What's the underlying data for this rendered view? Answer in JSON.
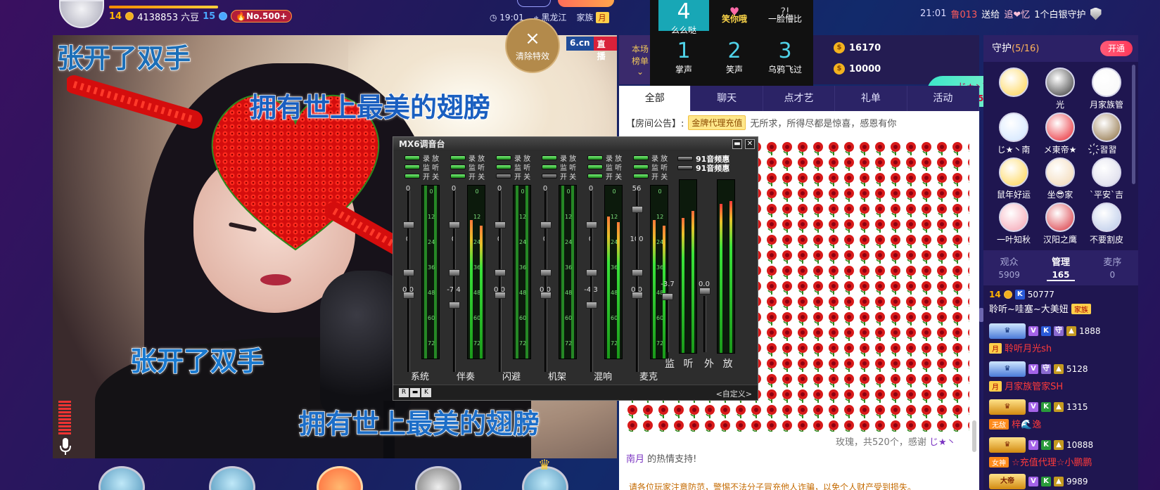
{
  "topbar": {
    "level": "14",
    "coins": "4138853 六豆",
    "level2": "15",
    "rank": "No.500+",
    "level_progress_percent": 100,
    "time": "19:01",
    "location": "黑龙江",
    "clan_label": "家族",
    "clan_tag": "月",
    "notice_time": "21:01",
    "notice_user": "鲁013",
    "notice_verb": "送给",
    "notice_target": "追❤忆",
    "notice_gift": "1个白银守护"
  },
  "video": {
    "brand": "6.cn",
    "live_label": "直播",
    "lyric_1": "张开了双手",
    "lyric_2": "拥有世上最美的翅膀",
    "lyric_3": "张开了双手",
    "lyric_4": "拥有世上最美的翅膀",
    "clear_effects": "清除特效",
    "clear_icon": "×"
  },
  "rank": {
    "label": "本场\n榜单",
    "coins_1": "16170",
    "coins_2": "10000"
  },
  "sfx": {
    "items": [
      {
        "num": "4",
        "label": "么么哒"
      },
      {
        "num": "",
        "label": "笑你哦"
      },
      {
        "num": "",
        "label": "一脸懵比"
      },
      {
        "num": "1",
        "label": "掌声"
      },
      {
        "num": "2",
        "label": "笑声"
      },
      {
        "num": "3",
        "label": "乌鸦飞过"
      }
    ]
  },
  "gift_banner": {
    "name": "じ★丶南月",
    "gift": "玫瑰",
    "qty": "520个"
  },
  "chat": {
    "tabs": [
      "全部",
      "聊天",
      "点才艺",
      "礼单",
      "活动"
    ],
    "announce_label": "【房间公告】:",
    "announce_btn": "金牌代理充值",
    "announce_text": "无所求，所得尽都是惊喜，感恩有你",
    "thanks_a": "玫瑰，共520个，感谢",
    "thanks_name_a": "じ★丶",
    "thanks_name_b": "南月",
    "thanks_b": "的热情支持!",
    "warning": "请各位玩家注意防范，警惕不法分子冒充他人诈骗，以免个人财产受到损失。"
  },
  "mixer": {
    "title": "MX6调音台",
    "sw_labels": [
      "录 放",
      "监 听",
      "开 关"
    ],
    "presets": [
      "91音频惠",
      "91音频惠"
    ],
    "custom": "<自定义>",
    "footer_btns": [
      "R",
      "▬",
      "K"
    ],
    "strips": [
      {
        "label": "系统",
        "top": "0",
        "mid": "0",
        "val": "0.0",
        "level": 0
      },
      {
        "label": "伴奏",
        "top": "0",
        "mid": "0",
        "val": "-7.4",
        "level": 0.8
      },
      {
        "label": "闪避",
        "top": "0",
        "mid": "0",
        "val": "0.0",
        "level": 0
      },
      {
        "label": "机架",
        "top": "0",
        "mid": "0",
        "val": "0.0",
        "level": 0
      },
      {
        "label": "混响",
        "top": "0",
        "mid": "0",
        "val": "-4.3",
        "level": 0.82
      },
      {
        "label": "麦克",
        "top": "56",
        "mid": "100",
        "val": "0.0",
        "level": 0.8
      }
    ],
    "master": {
      "left_val": "-3.7",
      "right_val": "0.0",
      "monitor": "监 听",
      "playback": "外 放"
    },
    "scale": [
      "0",
      "12",
      "24",
      "36",
      "48",
      "60",
      "72"
    ]
  },
  "side": {
    "title": "守护",
    "count": "(5/16)",
    "open_btn": "开通",
    "guards": [
      {
        "name": ""
      },
      {
        "name": "光"
      },
      {
        "name": "月家族管"
      },
      {
        "name": "じ★丶南"
      },
      {
        "name": "メ東帝★"
      },
      {
        "name": "҉習習"
      },
      {
        "name": "鼠年好运"
      },
      {
        "name": "坐😎家"
      },
      {
        "name": "`平安`吉"
      },
      {
        "name": "一叶知秋"
      },
      {
        "name": "汉阳之鹰"
      },
      {
        "name": "不要割皮"
      }
    ],
    "tabs": [
      {
        "label": "观众",
        "value": "5909"
      },
      {
        "label": "管理",
        "value": "165"
      },
      {
        "label": "麦序",
        "value": "0"
      }
    ],
    "managers": [
      {
        "lvl": "14",
        "id": "50777",
        "name": "聆听~哇塞~大美妞",
        "tag": "家族"
      },
      {
        "id": "1888",
        "name": "聆听月光sh",
        "tag": "月"
      },
      {
        "id": "5128",
        "name": "月家族管家SH",
        "tag": "月"
      },
      {
        "id": "1315",
        "name": "梓🌊逸",
        "tag": "无敌"
      },
      {
        "id": "10888",
        "name": "☆充值代理☆小鹏鹏",
        "tag": "女神"
      },
      {
        "id": "9989",
        "name": "",
        "tag": "大帝"
      }
    ]
  }
}
